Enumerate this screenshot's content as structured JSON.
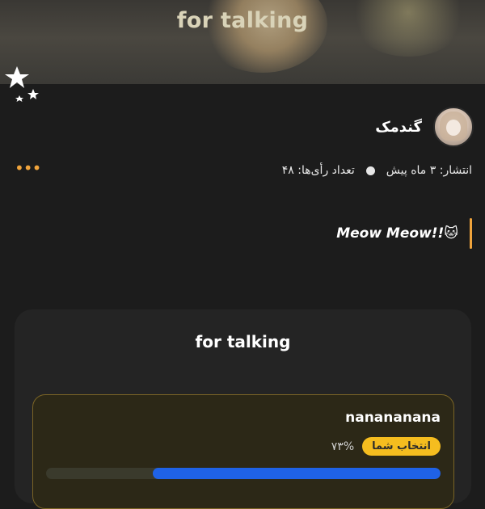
{
  "header": {
    "title": "for talking"
  },
  "post": {
    "author": "گندمک",
    "published": "انتشار: ۳ ماه پیش",
    "votes": "تعداد رأی‌ها: ۴۸",
    "text": "Meow Meow!!🐱"
  },
  "poll": {
    "title": "for talking",
    "options": [
      {
        "label": "nanananana",
        "badge": "انتخاب شما",
        "percent_label": "۷۳%",
        "percent": 73
      }
    ]
  },
  "colors": {
    "accent": "#f0a43c",
    "badge": "#f5bd1f",
    "bar": "#1f62e6"
  },
  "icons": {
    "more": "more-dots-icon",
    "stars": "stars-icon",
    "avatar": "avatar"
  }
}
